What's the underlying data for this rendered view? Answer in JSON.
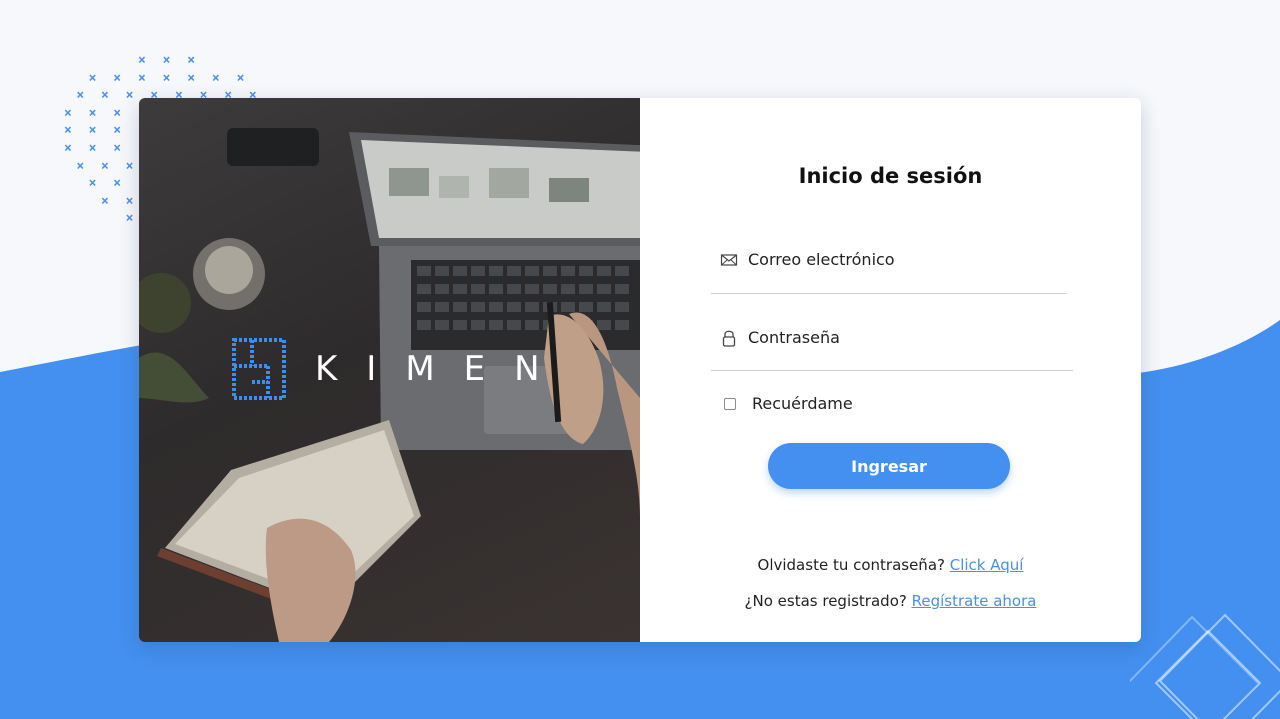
{
  "brand": {
    "name": "KIMEN"
  },
  "login": {
    "title": "Inicio de sesión",
    "email_placeholder": "Correo electrónico",
    "password_placeholder": "Contraseña",
    "remember_label": "Recuérdame",
    "submit_label": "Ingresar",
    "forgot_text": "Olvidaste tu contraseña? ",
    "forgot_link": "Click Aquí",
    "register_text": "¿No estas registrado? ",
    "register_link": " Regístrate ahora"
  },
  "icons": {
    "email": "envelope-icon",
    "password": "lock-icon"
  },
  "colors": {
    "accent": "#4390f0",
    "background_wave": "#4390f0",
    "link": "#4a90e2"
  }
}
